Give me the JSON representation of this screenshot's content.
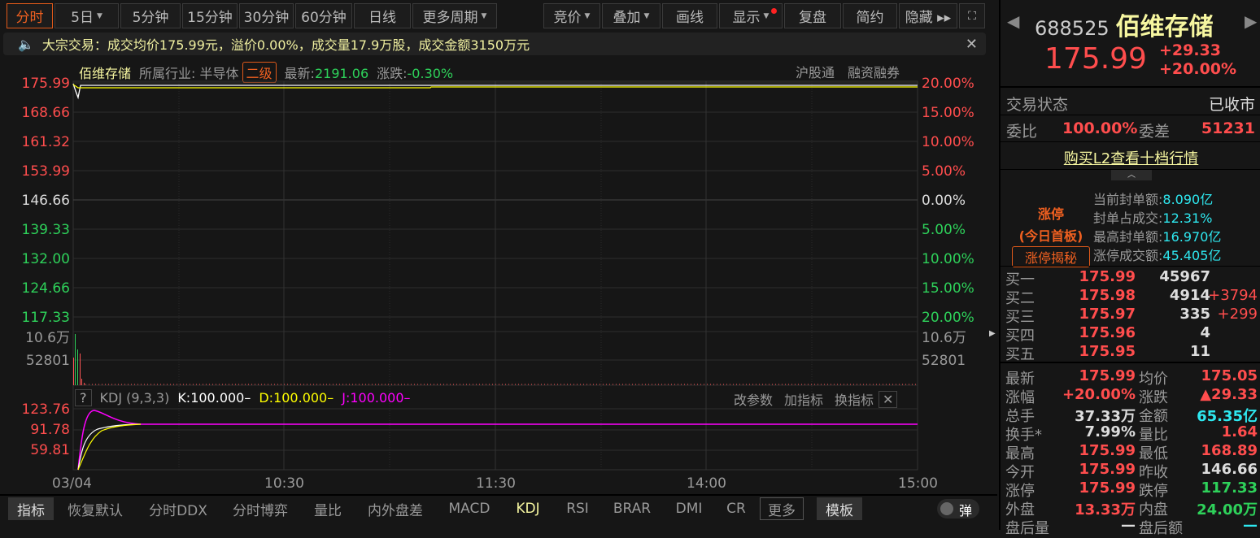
{
  "toolbar": {
    "left": [
      {
        "label": "分时",
        "active": true
      },
      {
        "label": "5日",
        "caret": true
      },
      {
        "label": "5分钟"
      },
      {
        "label": "15分钟"
      },
      {
        "label": "30分钟"
      },
      {
        "label": "60分钟"
      },
      {
        "label": "日线"
      },
      {
        "label": "更多周期",
        "caret": true
      }
    ],
    "right": [
      {
        "label": "竞价",
        "caret": true
      },
      {
        "label": "叠加",
        "caret": true
      },
      {
        "label": "画线"
      },
      {
        "label": "显示",
        "caret": true,
        "dot": true
      },
      {
        "label": "复盘"
      },
      {
        "label": "简约"
      },
      {
        "label": "隐藏 ▸▸"
      }
    ]
  },
  "notice": {
    "text": "大宗交易：成交均价175.99元，溢价0.00%，成交量17.9万股，成交金额3150万元"
  },
  "chart_header": {
    "name": "佰维存储",
    "industry_label": "所属行业:",
    "industry": "半导体",
    "level": "二级",
    "latest_label": "最新:",
    "latest": "2191.06",
    "change_label": "涨跌:",
    "change": "-0.30%",
    "tags": [
      "沪股通",
      "融资融券"
    ]
  },
  "price_axis": {
    "left": [
      "175.99",
      "168.66",
      "161.32",
      "153.99",
      "146.66",
      "139.33",
      "132.00",
      "124.66",
      "117.33"
    ],
    "right": [
      "20.00%",
      "15.00%",
      "10.00%",
      "5.00%",
      "0.00%",
      "5.00%",
      "10.00%",
      "15.00%",
      "20.00%"
    ]
  },
  "volume_axis": {
    "left": [
      "10.6万",
      "52801"
    ],
    "right": [
      "10.6万",
      "52801"
    ]
  },
  "kdj": {
    "help": "?",
    "title": "KDJ (9,3,3)",
    "k": "K:100.000–",
    "d": "D:100.000–",
    "j": "J:100.000–",
    "actions": [
      "改参数",
      "加指标",
      "换指标"
    ],
    "axis": [
      "123.76",
      "91.78",
      "59.81"
    ]
  },
  "time_axis": [
    "03/04",
    "10:30",
    "11:30",
    "14:00",
    "15:00"
  ],
  "bottom_tabs": [
    "指标",
    "恢复默认",
    "分时DDX",
    "分时博弈",
    "量比",
    "内外盘差",
    "MACD",
    "KDJ",
    "RSI",
    "BRAR",
    "DMI",
    "CR",
    "更多",
    "模板"
  ],
  "toggle_label": "弹",
  "quote": {
    "code": "688525",
    "name": "佰维存储",
    "price": "175.99",
    "change": "+29.33",
    "pct": "+20.00%",
    "status_label": "交易状态",
    "status": "已收市",
    "wb_label": "委比",
    "wb": "100.00%",
    "wc_label": "委差",
    "wc": "51231",
    "l2_link": "购买L2查看十档行情",
    "limit": {
      "title": "涨停",
      "sub": "(今日首板)",
      "btn": "涨停揭秘",
      "items": [
        {
          "k": "当前封单额:",
          "v": "8.090亿"
        },
        {
          "k": "封单占成交:",
          "v": "12.31%"
        },
        {
          "k": "最高封单额:",
          "v": "16.970亿"
        },
        {
          "k": "涨停成交额:",
          "v": "45.405亿"
        }
      ]
    },
    "bids": [
      {
        "l": "买一",
        "p": "175.99",
        "v": "45967",
        "d": ""
      },
      {
        "l": "买二",
        "p": "175.98",
        "v": "4914",
        "d": "+3794"
      },
      {
        "l": "买三",
        "p": "175.97",
        "v": "335",
        "d": "+299"
      },
      {
        "l": "买四",
        "p": "175.96",
        "v": "4",
        "d": ""
      },
      {
        "l": "买五",
        "p": "175.95",
        "v": "11",
        "d": ""
      }
    ],
    "stats": [
      {
        "l1": "最新",
        "v1": "175.99",
        "c1": "red",
        "l2": "均价",
        "v2": "175.05",
        "c2": "red"
      },
      {
        "l1": "涨幅",
        "v1": "+20.00%",
        "c1": "red",
        "l2": "涨跌",
        "v2": "▲29.33",
        "c2": "red"
      },
      {
        "l1": "总手",
        "v1": "37.33万",
        "c1": "white",
        "l2": "金额",
        "v2": "65.35亿",
        "c2": "cyan"
      },
      {
        "l1": "换手*",
        "v1": "7.99%",
        "c1": "white",
        "l2": "量比",
        "v2": "1.64",
        "c2": "red"
      },
      {
        "l1": "最高",
        "v1": "175.99",
        "c1": "red",
        "l2": "最低",
        "v2": "168.89",
        "c2": "red"
      },
      {
        "l1": "今开",
        "v1": "175.99",
        "c1": "red",
        "l2": "昨收",
        "v2": "146.66",
        "c2": "white"
      },
      {
        "l1": "涨停",
        "v1": "175.99",
        "c1": "red",
        "l2": "跌停",
        "v2": "117.33",
        "c2": "green"
      },
      {
        "l1": "外盘",
        "v1": "13.33万",
        "c1": "red",
        "l2": "内盘",
        "v2": "24.00万",
        "c2": "green"
      },
      {
        "l1": "盘后量",
        "v1": "—",
        "c1": "white",
        "l2": "盘后额",
        "v2": "—",
        "c2": "cyan"
      }
    ]
  }
}
